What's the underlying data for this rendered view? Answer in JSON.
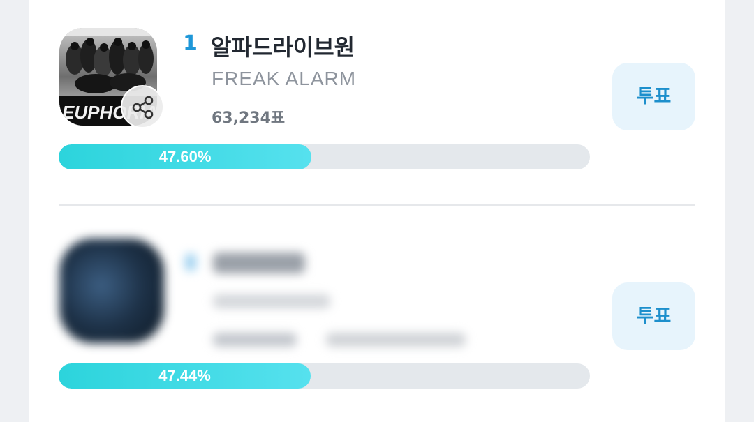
{
  "entries": [
    {
      "rank": "1",
      "title": "알파드라이브원",
      "subtitle": "FREAK ALARM",
      "votes": "63,234표",
      "percent_label": "47.60%",
      "percent_value": 47.6,
      "vote_label": "투표",
      "album_text": "EUPHORIA",
      "share_icon": "share-icon"
    },
    {
      "percent_label": "47.44%",
      "percent_value": 47.44,
      "vote_label": "투표"
    }
  ],
  "colors": {
    "accent": "#1e97d8",
    "bar_fill": "#2cd4dc",
    "bar_track": "#e4e8ec",
    "vote_button_bg": "#e7f4fc",
    "vote_button_text": "#1d8fcc"
  }
}
